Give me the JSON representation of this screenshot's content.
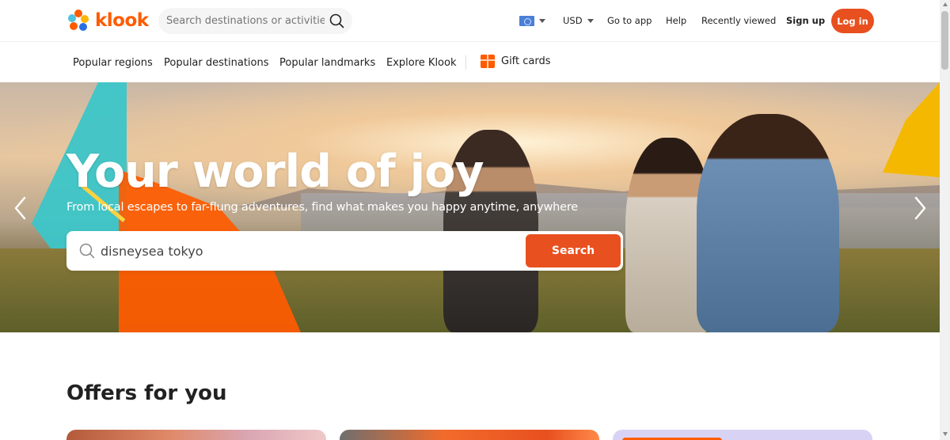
{
  "header": {
    "logo_text": "klook",
    "search_placeholder": "Search destinations or activities",
    "language_icon": "flag-icon",
    "currency": "USD",
    "go_to_app": "Go to app",
    "help": "Help",
    "recently_viewed": "Recently viewed",
    "sign_up": "Sign up",
    "log_in": "Log in"
  },
  "subnav": {
    "items": [
      "Popular regions",
      "Popular destinations",
      "Popular landmarks",
      "Explore Klook"
    ],
    "gift_cards": "Gift cards"
  },
  "hero": {
    "title": "Your world of joy",
    "subtitle": "From local escapes to far-flung adventures, find what makes you happy anytime, anywhere",
    "search_value": "disneysea tokyo",
    "search_button": "Search"
  },
  "offers": {
    "title": "Offers for you"
  },
  "colors": {
    "brand": "#ff5b00",
    "button": "#e8501f"
  }
}
